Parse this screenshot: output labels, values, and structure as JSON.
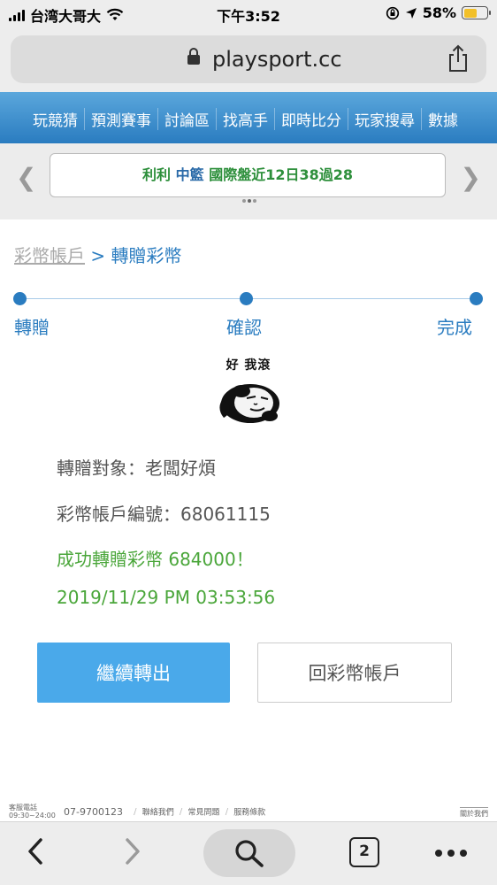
{
  "status_bar": {
    "carrier": "台湾大哥大",
    "time": "下午3:52",
    "battery": "58%",
    "battery_level": 0.58
  },
  "browser": {
    "url": "playsport.cc"
  },
  "site_nav": {
    "items": [
      "玩競猜",
      "預測賽事",
      "討論區",
      "找高手",
      "即時比分",
      "玩家搜尋",
      "數據"
    ]
  },
  "banner": {
    "part_a": "利利",
    "part_b": "中籃",
    "part_c": "國際盤近12日38過28"
  },
  "breadcrumb": {
    "root": "彩幣帳戶",
    "separator": ">",
    "current": "轉贈彩幣"
  },
  "steps": [
    "轉贈",
    "確認",
    "完成"
  ],
  "meme": {
    "caption": "好 我滾"
  },
  "transfer": {
    "recipient_label": "轉贈對象：",
    "recipient": "老闆好煩",
    "account_label": "彩幣帳戶編號：",
    "account_no": "68061115",
    "success_msg": "成功轉贈彩幣 684000！",
    "timestamp": "2019/11/29 PM 03:53:56"
  },
  "buttons": {
    "continue": "繼續轉出",
    "back_account": "回彩幣帳戶"
  },
  "footer": {
    "phone_label": "客服電話",
    "hours": "09:30~24:00",
    "phone": "07-9700123",
    "links": [
      "聯絡我們",
      "常見問題",
      "服務條款"
    ],
    "about": "關於我們"
  },
  "toolbar": {
    "tab_count": "2"
  },
  "colors": {
    "brand_blue": "#2a7cc0",
    "button_blue": "#4aa9ea",
    "success_green": "#4aa63a"
  }
}
